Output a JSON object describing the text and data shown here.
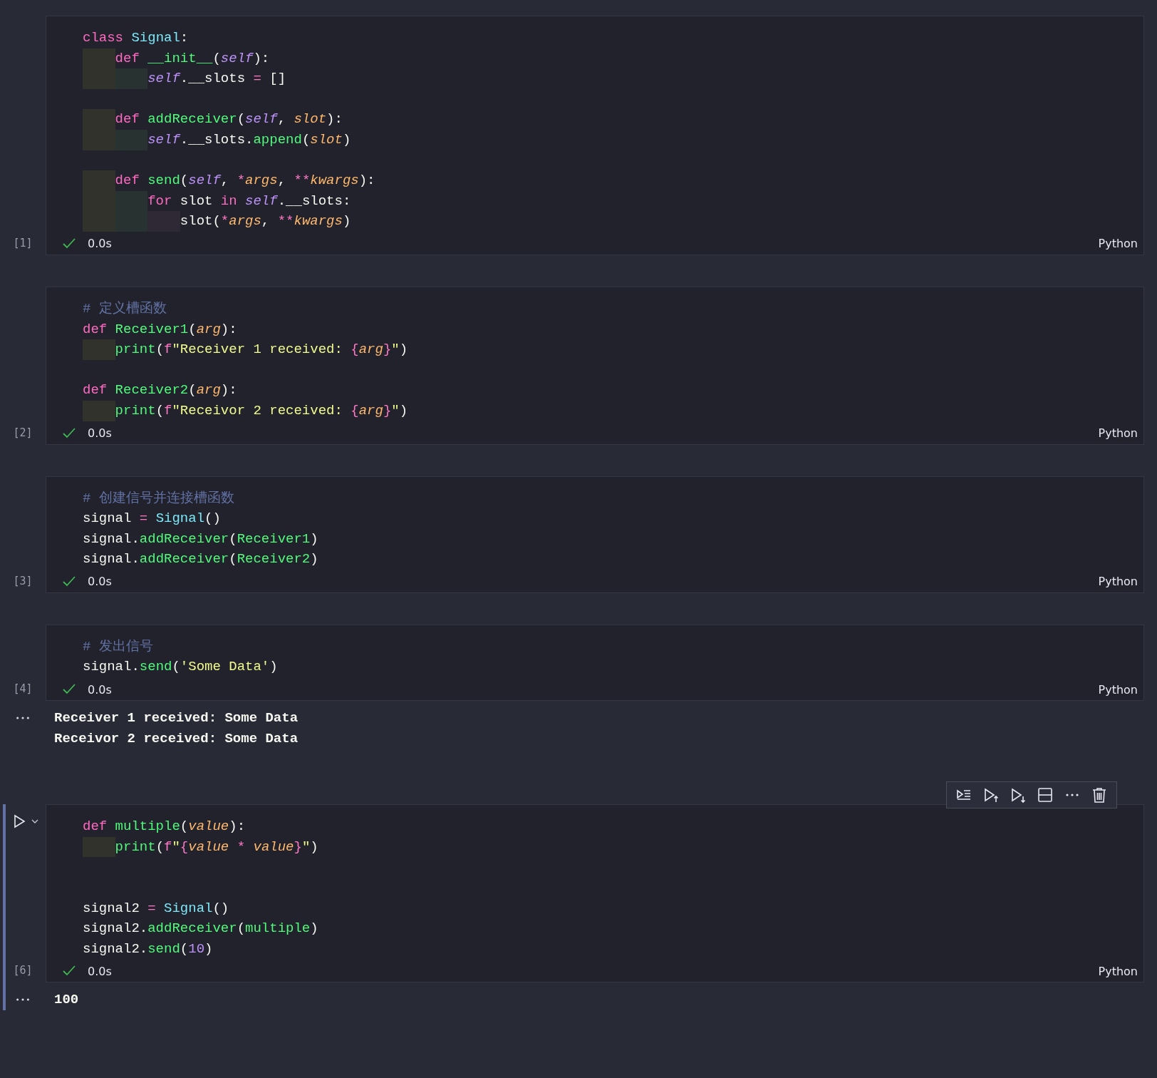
{
  "cells": [
    {
      "execution_count": "[1]",
      "succeeded": true,
      "duration": "0.0s",
      "language": "Python",
      "selected": false,
      "lines": [
        {
          "kind": "code",
          "tokens": [
            {
              "kind": "keyword",
              "text": "class "
            },
            {
              "kind": "class",
              "text": "Signal"
            },
            {
              "kind": "plain",
              "text": ":"
            }
          ],
          "children": [
            {
              "kind": "code",
              "tokens": [
                {
                  "kind": "keyword",
                  "text": "def "
                },
                {
                  "kind": "func",
                  "text": "__init__"
                },
                {
                  "kind": "plain",
                  "text": "("
                },
                {
                  "kind": "self",
                  "text": "self"
                },
                {
                  "kind": "plain",
                  "text": "):"
                }
              ],
              "children": [
                {
                  "kind": "code",
                  "tokens": [
                    {
                      "kind": "self",
                      "text": "self"
                    },
                    {
                      "kind": "plain",
                      "text": ".__slots "
                    },
                    {
                      "kind": "op",
                      "text": "= "
                    },
                    {
                      "kind": "plain",
                      "text": "[]"
                    }
                  ]
                }
              ]
            },
            {
              "kind": "blank"
            },
            {
              "kind": "code",
              "tokens": [
                {
                  "kind": "keyword",
                  "text": "def "
                },
                {
                  "kind": "func",
                  "text": "addReceiver"
                },
                {
                  "kind": "plain",
                  "text": "("
                },
                {
                  "kind": "self",
                  "text": "self"
                },
                {
                  "kind": "plain",
                  "text": ", "
                },
                {
                  "kind": "param",
                  "text": "slot"
                },
                {
                  "kind": "plain",
                  "text": "):"
                }
              ],
              "children": [
                {
                  "kind": "code",
                  "tokens": [
                    {
                      "kind": "self",
                      "text": "self"
                    },
                    {
                      "kind": "plain",
                      "text": ".__slots."
                    },
                    {
                      "kind": "func",
                      "text": "append"
                    },
                    {
                      "kind": "plain",
                      "text": "("
                    },
                    {
                      "kind": "param",
                      "text": "slot"
                    },
                    {
                      "kind": "plain",
                      "text": ")"
                    }
                  ]
                }
              ]
            },
            {
              "kind": "blank"
            },
            {
              "kind": "code",
              "tokens": [
                {
                  "kind": "keyword",
                  "text": "def "
                },
                {
                  "kind": "func",
                  "text": "send"
                },
                {
                  "kind": "plain",
                  "text": "("
                },
                {
                  "kind": "self",
                  "text": "self"
                },
                {
                  "kind": "plain",
                  "text": ", "
                },
                {
                  "kind": "op",
                  "text": "*"
                },
                {
                  "kind": "param",
                  "text": "args"
                },
                {
                  "kind": "plain",
                  "text": ", "
                },
                {
                  "kind": "op",
                  "text": "**"
                },
                {
                  "kind": "param",
                  "text": "kwargs"
                },
                {
                  "kind": "plain",
                  "text": "):"
                }
              ],
              "children": [
                {
                  "kind": "code",
                  "tokens": [
                    {
                      "kind": "keyword",
                      "text": "for "
                    },
                    {
                      "kind": "plain",
                      "text": "slot "
                    },
                    {
                      "kind": "keyword",
                      "text": "in "
                    },
                    {
                      "kind": "self",
                      "text": "self"
                    },
                    {
                      "kind": "plain",
                      "text": ".__slots:"
                    }
                  ],
                  "children": [
                    {
                      "kind": "code",
                      "tokens": [
                        {
                          "kind": "plain",
                          "text": "slot("
                        },
                        {
                          "kind": "op",
                          "text": "*"
                        },
                        {
                          "kind": "param",
                          "text": "args"
                        },
                        {
                          "kind": "plain",
                          "text": ", "
                        },
                        {
                          "kind": "op",
                          "text": "**"
                        },
                        {
                          "kind": "param",
                          "text": "kwargs"
                        },
                        {
                          "kind": "plain",
                          "text": ")"
                        }
                      ]
                    }
                  ]
                }
              ]
            }
          ]
        }
      ]
    },
    {
      "execution_count": "[2]",
      "succeeded": true,
      "duration": "0.0s",
      "language": "Python",
      "selected": false,
      "lines": [
        {
          "kind": "code",
          "tokens": [
            {
              "kind": "comment",
              "text": "# 定义槽函数"
            }
          ]
        },
        {
          "kind": "code",
          "tokens": [
            {
              "kind": "keyword",
              "text": "def "
            },
            {
              "kind": "func",
              "text": "Receiver1"
            },
            {
              "kind": "plain",
              "text": "("
            },
            {
              "kind": "param",
              "text": "arg"
            },
            {
              "kind": "plain",
              "text": "):"
            }
          ],
          "children": [
            {
              "kind": "code",
              "tokens": [
                {
                  "kind": "func",
                  "text": "print"
                },
                {
                  "kind": "plain",
                  "text": "("
                },
                {
                  "kind": "op",
                  "text": "f"
                },
                {
                  "kind": "string",
                  "text": "\"Receiver 1 received: "
                },
                {
                  "kind": "op",
                  "text": "{"
                },
                {
                  "kind": "param",
                  "text": "arg"
                },
                {
                  "kind": "op",
                  "text": "}"
                },
                {
                  "kind": "string",
                  "text": "\""
                },
                {
                  "kind": "plain",
                  "text": ")"
                }
              ]
            }
          ]
        },
        {
          "kind": "blank"
        },
        {
          "kind": "code",
          "tokens": [
            {
              "kind": "keyword",
              "text": "def "
            },
            {
              "kind": "func",
              "text": "Receiver2"
            },
            {
              "kind": "plain",
              "text": "("
            },
            {
              "kind": "param",
              "text": "arg"
            },
            {
              "kind": "plain",
              "text": "):"
            }
          ],
          "children": [
            {
              "kind": "code",
              "tokens": [
                {
                  "kind": "func",
                  "text": "print"
                },
                {
                  "kind": "plain",
                  "text": "("
                },
                {
                  "kind": "op",
                  "text": "f"
                },
                {
                  "kind": "string",
                  "text": "\"Receivor 2 received: "
                },
                {
                  "kind": "op",
                  "text": "{"
                },
                {
                  "kind": "param",
                  "text": "arg"
                },
                {
                  "kind": "op",
                  "text": "}"
                },
                {
                  "kind": "string",
                  "text": "\""
                },
                {
                  "kind": "plain",
                  "text": ")"
                }
              ]
            }
          ]
        }
      ]
    },
    {
      "execution_count": "[3]",
      "succeeded": true,
      "duration": "0.0s",
      "language": "Python",
      "selected": false,
      "lines": [
        {
          "kind": "code",
          "tokens": [
            {
              "kind": "comment",
              "text": "# 创建信号并连接槽函数"
            }
          ]
        },
        {
          "kind": "code",
          "tokens": [
            {
              "kind": "plain",
              "text": "signal "
            },
            {
              "kind": "op",
              "text": "= "
            },
            {
              "kind": "class",
              "text": "Signal"
            },
            {
              "kind": "plain",
              "text": "()"
            }
          ]
        },
        {
          "kind": "code",
          "tokens": [
            {
              "kind": "plain",
              "text": "signal."
            },
            {
              "kind": "func",
              "text": "addReceiver"
            },
            {
              "kind": "plain",
              "text": "("
            },
            {
              "kind": "func",
              "text": "Receiver1"
            },
            {
              "kind": "plain",
              "text": ")"
            }
          ]
        },
        {
          "kind": "code",
          "tokens": [
            {
              "kind": "plain",
              "text": "signal."
            },
            {
              "kind": "func",
              "text": "addReceiver"
            },
            {
              "kind": "plain",
              "text": "("
            },
            {
              "kind": "func",
              "text": "Receiver2"
            },
            {
              "kind": "plain",
              "text": ")"
            }
          ]
        }
      ]
    },
    {
      "execution_count": "[4]",
      "succeeded": true,
      "duration": "0.0s",
      "language": "Python",
      "selected": false,
      "lines": [
        {
          "kind": "code",
          "tokens": [
            {
              "kind": "comment",
              "text": "# 发出信号"
            }
          ]
        },
        {
          "kind": "code",
          "tokens": [
            {
              "kind": "plain",
              "text": "signal."
            },
            {
              "kind": "func",
              "text": "send"
            },
            {
              "kind": "plain",
              "text": "("
            },
            {
              "kind": "string",
              "text": "'Some Data'"
            },
            {
              "kind": "plain",
              "text": ")"
            }
          ]
        }
      ],
      "output": [
        "Receiver 1 received: Some Data",
        "Receivor 2 received: Some Data"
      ]
    },
    {
      "execution_count": "[6]",
      "succeeded": true,
      "duration": "0.0s",
      "language": "Python",
      "selected": true,
      "lines": [
        {
          "kind": "code",
          "tokens": [
            {
              "kind": "keyword",
              "text": "def "
            },
            {
              "kind": "func",
              "text": "multiple"
            },
            {
              "kind": "plain",
              "text": "("
            },
            {
              "kind": "param",
              "text": "value"
            },
            {
              "kind": "plain",
              "text": "):"
            }
          ],
          "children": [
            {
              "kind": "code",
              "tokens": [
                {
                  "kind": "func",
                  "text": "print"
                },
                {
                  "kind": "plain",
                  "text": "("
                },
                {
                  "kind": "op",
                  "text": "f"
                },
                {
                  "kind": "string",
                  "text": "\""
                },
                {
                  "kind": "op",
                  "text": "{"
                },
                {
                  "kind": "param",
                  "text": "value "
                },
                {
                  "kind": "op",
                  "text": "* "
                },
                {
                  "kind": "param",
                  "text": "value"
                },
                {
                  "kind": "op",
                  "text": "}"
                },
                {
                  "kind": "string",
                  "text": "\""
                },
                {
                  "kind": "plain",
                  "text": ")"
                }
              ]
            }
          ]
        },
        {
          "kind": "blank"
        },
        {
          "kind": "blank"
        },
        {
          "kind": "code",
          "tokens": [
            {
              "kind": "plain",
              "text": "signal2 "
            },
            {
              "kind": "op",
              "text": "= "
            },
            {
              "kind": "class",
              "text": "Signal"
            },
            {
              "kind": "plain",
              "text": "()"
            }
          ]
        },
        {
          "kind": "code",
          "tokens": [
            {
              "kind": "plain",
              "text": "signal2."
            },
            {
              "kind": "func",
              "text": "addReceiver"
            },
            {
              "kind": "plain",
              "text": "("
            },
            {
              "kind": "func",
              "text": "multiple"
            },
            {
              "kind": "plain",
              "text": ")"
            }
          ]
        },
        {
          "kind": "code",
          "tokens": [
            {
              "kind": "plain",
              "text": "signal2."
            },
            {
              "kind": "func",
              "text": "send"
            },
            {
              "kind": "plain",
              "text": "("
            },
            {
              "kind": "number",
              "text": "10"
            },
            {
              "kind": "plain",
              "text": ")"
            }
          ]
        }
      ],
      "output": [
        "100"
      ]
    }
  ]
}
